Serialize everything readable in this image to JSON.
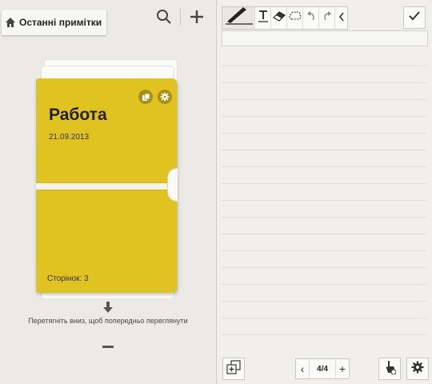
{
  "header": {
    "home_label": "Останні примітки"
  },
  "notebook": {
    "title": "Работа",
    "date": "21.09.2013",
    "pages": "Сторінок: 3",
    "cover_color": "#e0c221"
  },
  "hint": "Перетягніть вниз, щоб попередньо переглянути",
  "editor": {
    "page_indicator": "4/4",
    "prev_label": "‹",
    "next_label": "+"
  },
  "icons": [
    "home-icon",
    "search-icon",
    "add-icon",
    "photo-icon",
    "settings-icon",
    "down-arrow-icon",
    "pen-icon",
    "text-icon",
    "eraser-icon",
    "lasso-icon",
    "undo-icon",
    "redo-icon",
    "chevron-left-icon",
    "check-icon",
    "insert-image-icon",
    "touch-icon"
  ]
}
